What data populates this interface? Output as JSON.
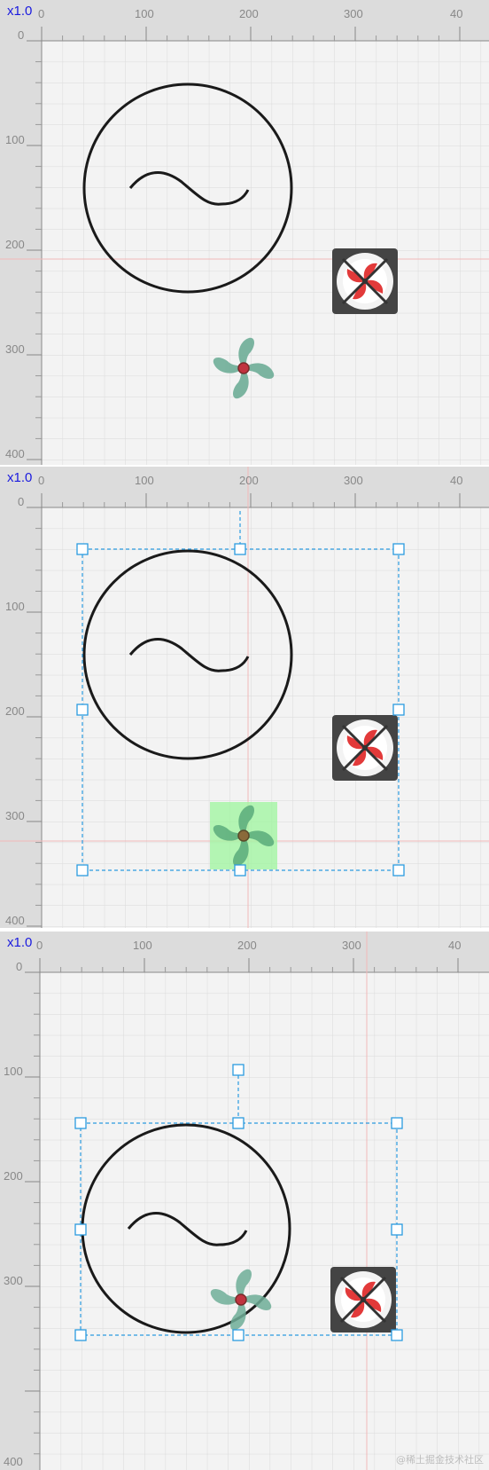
{
  "panels": [
    {
      "zoom": "x1.0",
      "x_ticks": [
        "0",
        "100",
        "200",
        "300",
        "40"
      ],
      "y_ticks": [
        "0",
        "100",
        "200",
        "300",
        "400"
      ],
      "selection": "none"
    },
    {
      "zoom": "x1.0",
      "x_ticks": [
        "0",
        "100",
        "200",
        "300",
        "40"
      ],
      "y_ticks": [
        "0",
        "100",
        "200",
        "300",
        "400"
      ],
      "selection": "group",
      "hover_highlight": "fan-plant"
    },
    {
      "zoom": "x1.0",
      "x_ticks": [
        "0",
        "100",
        "200",
        "300",
        "40"
      ],
      "y_ticks": [
        "0",
        "100",
        "200",
        "300",
        "400"
      ],
      "selection": "group"
    }
  ],
  "shapes": [
    "ac-source-symbol",
    "green-fan",
    "exhaust-fan"
  ],
  "colors": {
    "ruler_bg": "#dedede",
    "canvas_bg": "#f2f2f2",
    "grid": "#dadada",
    "guide": "#f2b8b8",
    "selection": "#2b9be0",
    "fan_green": "#6fae98",
    "fan_red": "#e23a3a",
    "hover_fill": "#9ef59e"
  },
  "watermark": "@稀土掘金技术社区"
}
